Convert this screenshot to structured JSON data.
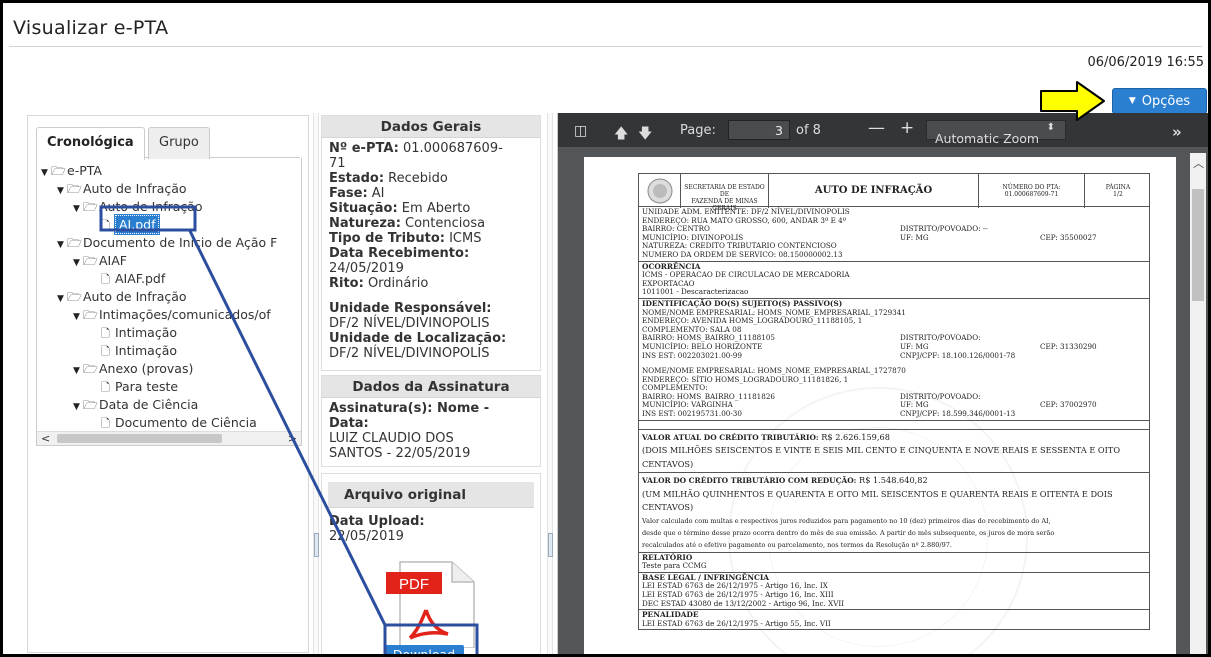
{
  "window": {
    "title": "Visualizar e-PTA",
    "datetime": "06/06/2019 16:55"
  },
  "options_button": {
    "label": "Opções",
    "icon": "caret-down-icon"
  },
  "tabs": [
    {
      "label": "Cronológica",
      "active": true
    },
    {
      "label": "Grupo",
      "active": false
    }
  ],
  "tree": [
    {
      "label": "e-PTA",
      "type": "folder",
      "depth": 0
    },
    {
      "label": "Auto de Infração",
      "type": "folder",
      "depth": 1
    },
    {
      "label": "Auto de Infração",
      "type": "folder",
      "depth": 2
    },
    {
      "label": "AI.pdf",
      "type": "file",
      "depth": 3,
      "selected": true
    },
    {
      "label": "Documento de Início de Ação F",
      "type": "folder",
      "depth": 1
    },
    {
      "label": "AIAF",
      "type": "folder",
      "depth": 2
    },
    {
      "label": "AIAF.pdf",
      "type": "file",
      "depth": 3
    },
    {
      "label": "Auto de Infração",
      "type": "folder",
      "depth": 1
    },
    {
      "label": "Intimações/comunicados/of",
      "type": "folder",
      "depth": 2
    },
    {
      "label": "Intimação",
      "type": "file",
      "depth": 3
    },
    {
      "label": "Intimação",
      "type": "file",
      "depth": 3
    },
    {
      "label": "Anexo (provas)",
      "type": "folder",
      "depth": 2
    },
    {
      "label": "Para teste",
      "type": "file",
      "depth": 3
    },
    {
      "label": "Data de Ciência",
      "type": "folder",
      "depth": 2
    },
    {
      "label": "Documento de Ciência",
      "type": "file",
      "depth": 3
    }
  ],
  "dados_gerais": {
    "title": "Dados Gerais",
    "numero_label": "Nº e-PTA:",
    "numero_a": " 01.000687609-",
    "numero_b": "71",
    "estado_label": "Estado:",
    "estado": " Recebido",
    "fase_label": "Fase:",
    "fase": " AI",
    "situacao_label": "Situação:",
    "situacao": " Em Aberto",
    "natureza_label": "Natureza:",
    "natureza": " Contenciosa",
    "tributo_label": "Tipo de Tributo:",
    "tributo": " ICMS",
    "recebimento_label": "Data Recebimento:",
    "recebimento": "24/05/2019",
    "rito_label": "Rito:",
    "rito": " Ordinário",
    "unidade_resp_label": "Unidade Responsável:",
    "unidade_resp": "DF/2 NÍVEL/DIVINOPOLIS",
    "unidade_loc_label": "Unidade de Localização:",
    "unidade_loc": "DF/2 NÍVEL/DIVINOPOLIS"
  },
  "assinatura": {
    "title": "Dados da Assinatura",
    "label_a": "Assinatura(s): Nome -",
    "label_b": "Data:",
    "value_a": "LUIZ CLAUDIO DOS",
    "value_b": "SANTOS - 22/05/2019"
  },
  "arquivo": {
    "title": "Arquivo original",
    "upload_label": "Data Upload:",
    "upload": "22/05/2019",
    "pdf_badge": "PDF",
    "download": "Download"
  },
  "viewer": {
    "page_label": "Page:",
    "page_current": "3",
    "page_of": "of 8",
    "zoom": "Automatic Zoom",
    "icons": [
      "sidebar-icon",
      "arrow-up-icon",
      "arrow-down-icon",
      "zoom-out-icon",
      "zoom-in-icon",
      "tools-icon"
    ]
  },
  "doc": {
    "header": {
      "secretaria_a": "SECRETARIA DE ESTADO DE",
      "secretaria_b": "FAZENDA DE MINAS GERAIS",
      "title": "AUTO DE INFRAÇÃO",
      "numero_label": "NÚMERO DO PTA:",
      "numero": "01.000687609-71",
      "pagina_label": "PÁGINA",
      "pagina": "1/2"
    },
    "unidade": {
      "l1": "UNIDADE ADM. EMITENTE: DF/2 NÍVEL/DIVINOPOLIS",
      "l2": "ENDEREÇO: RUA MATO GROSSO, 600, ANDAR 3º E 4º",
      "l3a": "BAIRRO: CENTRO",
      "l3b": "DISTRITO/POVOADO: --",
      "l4a": "MUNICÍPIO: DIVINOPOLIS",
      "l4b": "UF: MG",
      "l4c": "CEP: 35500027",
      "l5": "NATUREZA: CREDITO TRIBUTARIO CONTENCIOSO",
      "l6": "NUMERO DA ORDEM DE SERVICO: 08.150000002.13"
    },
    "ocorrencia": {
      "title": "OCORRÊNCIA",
      "l1": "ICMS - OPERACAO DE CIRCULACAO DE MERCADORIA",
      "l2": "EXPORTACAO",
      "l3": "1011001 - Descaracterizacao"
    },
    "sujeitos": {
      "title": "IDENTIFICAÇÃO DO(S) SUJEITO(S) PASSIVO(S)",
      "a1": "NOME/NOME EMPRESARIAL: HOMS_NOME_EMPRESARIAL_1729341",
      "a2": "ENDEREÇO: AVENIDA HOMS_LOGRADOURO_11188105, 1",
      "a3": "COMPLEMENTO: SALA 08",
      "a4a": "BAIRRO: HOMS_BAIRRO_11188105",
      "a4b": "DISTRITO/POVOADO:",
      "a5a": "MUNICÍPIO: BELO HORIZONTE",
      "a5b": "UF: MG",
      "a5c": "CEP: 31330290",
      "a6a": "INS EST: 002203021.00-99",
      "a6b": "CNPJ/CPF: 18.100.126/0001-78",
      "b1": "NOME/NOME EMPRESARIAL: HOMS_NOME_EMPRESARIAL_1727870",
      "b2": "ENDEREÇO: SÍTIO HOMS_LOGRADOURO_11181826, 1",
      "b3": "COMPLEMENTO:",
      "b4a": "BAIRRO: HOMS_BAIRRO_11181826",
      "b4b": "DISTRITO/POVOADO:",
      "b5a": "MUNICÍPIO: VARGINHA",
      "b5b": "UF: MG",
      "b5c": "CEP: 37002970",
      "b6a": "INS EST: 002195731.00-30",
      "b6b": "CNPJ/CPF: 18.599.346/0001-13"
    },
    "valor_atual": {
      "title": "VALOR ATUAL DO CRÉDITO TRIBUTÁRIO:",
      "value": " R$ 2.626.159,68",
      "ext_a": "(DOIS MILHÕES SEISCENTOS E VINTE E SEIS MIL CENTO E CINQUENTA E NOVE REAIS E SESSENTA E OITO",
      "ext_b": "CENTAVOS)"
    },
    "valor_red": {
      "title": "VALOR DO CRÉDITO TRIBUTÁRIO COM REDUÇÃO:",
      "value": " R$ 1.548.640,82",
      "ext_a": "(UM MILHÃO QUINHENTOS E QUARENTA E OITO MIL SEISCENTOS E QUARENTA REAIS E OITENTA E DOIS",
      "ext_b": "CENTAVOS)",
      "n1": "Valor calculado com multas e respectivos juros reduzidos para pagamento no 10 (dez) primeiros dias do recebimento do AI,",
      "n2": "desde que o término desse prazo ocorra dentro do mês de sua emissão. A partir do mês subsequente, os juros de mora serão",
      "n3": "recalculados até o efetivo pagamento ou parcelamento, nos termos da Resolução nº 2.880/97."
    },
    "relatorio": {
      "title": "RELATÓRIO",
      "l1": "Teste para CCMG"
    },
    "base_legal": {
      "title": "BASE LEGAL / INFRINGÊNCIA",
      "l1": "LEI ESTAD 6763 de 26/12/1975 - Artigo 16, Inc. IX",
      "l2": "LEI ESTAD 6763 de 26/12/1975 - Artigo 16, Inc. XIII",
      "l3": "DEC ESTAD 43080 de 13/12/2002 - Artigo 96, Inc. XVII"
    },
    "penalidade": {
      "title": "PENALIDADE",
      "l1": "LEI ESTAD 6763 de 26/12/1975 - Artigo 55, Inc. VII"
    }
  },
  "colors": {
    "accent": "#2a7fd0",
    "annotation_arrow": "#2b4f9e",
    "callout_fill": "#ffff00"
  }
}
